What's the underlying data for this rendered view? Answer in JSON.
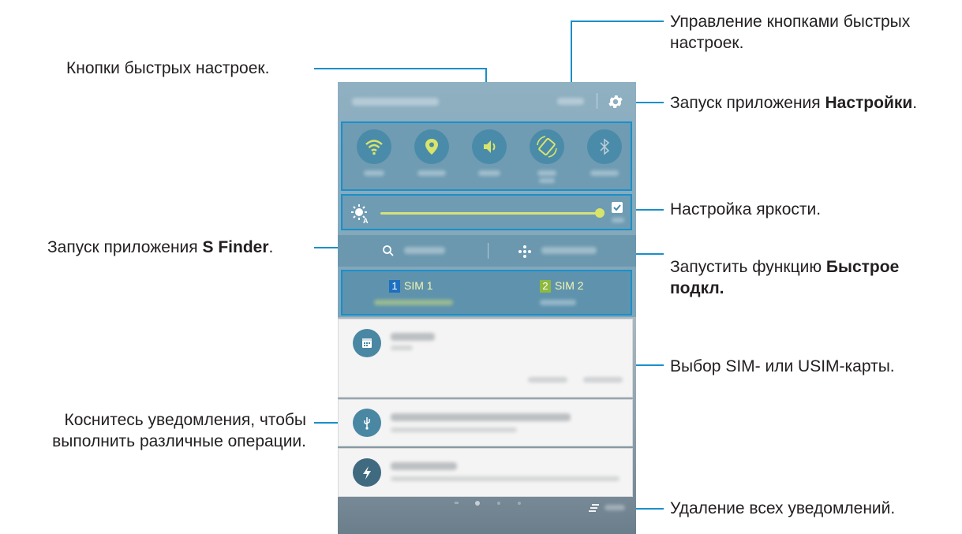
{
  "annotations": {
    "manage_buttons": "Управление кнопками быстрых настроек.",
    "quick_buttons": "Кнопки быстрых настроек.",
    "settings_prefix": "Запуск приложения ",
    "settings_bold": "Настройки",
    "settings_suffix": ".",
    "brightness": "Настройка яркости.",
    "sfinder_prefix": "Запуск приложения ",
    "sfinder_bold": "S Finder",
    "sfinder_suffix": ".",
    "quickconnect_prefix": "Запустить функцию ",
    "quickconnect_bold": "Быстрое подкл.",
    "sim_select": "Выбор SIM- или USIM-карты.",
    "notification": "Коснитесь уведомления, чтобы выполнить различные операции.",
    "clear_all": "Удаление всех уведомлений."
  },
  "sim": {
    "sim1_num": "1",
    "sim1_label": "SIM 1",
    "sim2_num": "2",
    "sim2_label": "SIM 2"
  },
  "colors": {
    "callout_line": "#1a8fc9",
    "panel": "#6f9cb3",
    "sim1_badge": "#1e6fbf",
    "sim2_badge": "#8db93e",
    "icon_accent": "#d9e46a"
  },
  "icons": [
    "wifi-icon",
    "location-icon",
    "sound-icon",
    "rotation-icon",
    "bluetooth-icon",
    "gear-icon",
    "brightness-icon",
    "search-icon",
    "quick-connect-icon",
    "calendar-icon",
    "usb-icon",
    "charging-icon",
    "clear-icon"
  ]
}
